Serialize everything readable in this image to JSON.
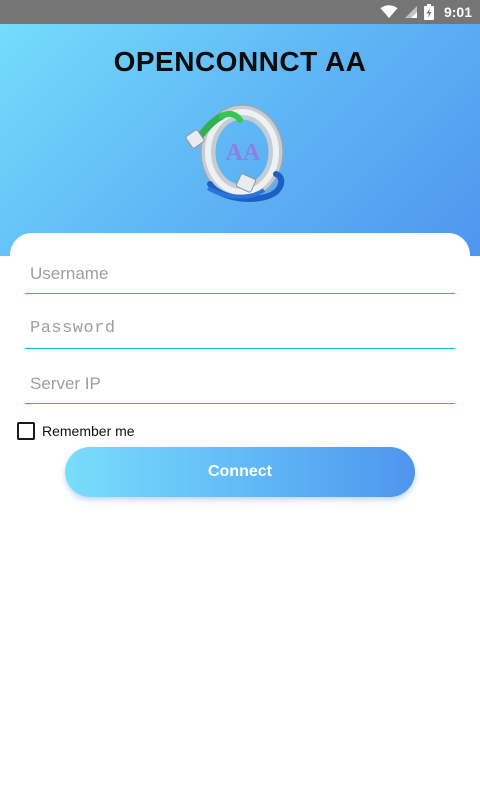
{
  "status_bar": {
    "time": "9:01",
    "icons": [
      "wifi-icon",
      "signal-icon",
      "battery-charging-icon"
    ]
  },
  "header": {
    "title": "OPENCONNCT AA",
    "logo_text": "AA",
    "gradient": [
      "#74dcfb",
      "#4f96ee"
    ]
  },
  "form": {
    "username_placeholder": "Username",
    "password_placeholder": "Password",
    "server_placeholder": "Server IP",
    "username_value": "",
    "password_value": "",
    "server_value": "",
    "remember_label": "Remember me",
    "remember_checked": false,
    "connect_label": "Connect",
    "accent": "#19b6d3"
  }
}
